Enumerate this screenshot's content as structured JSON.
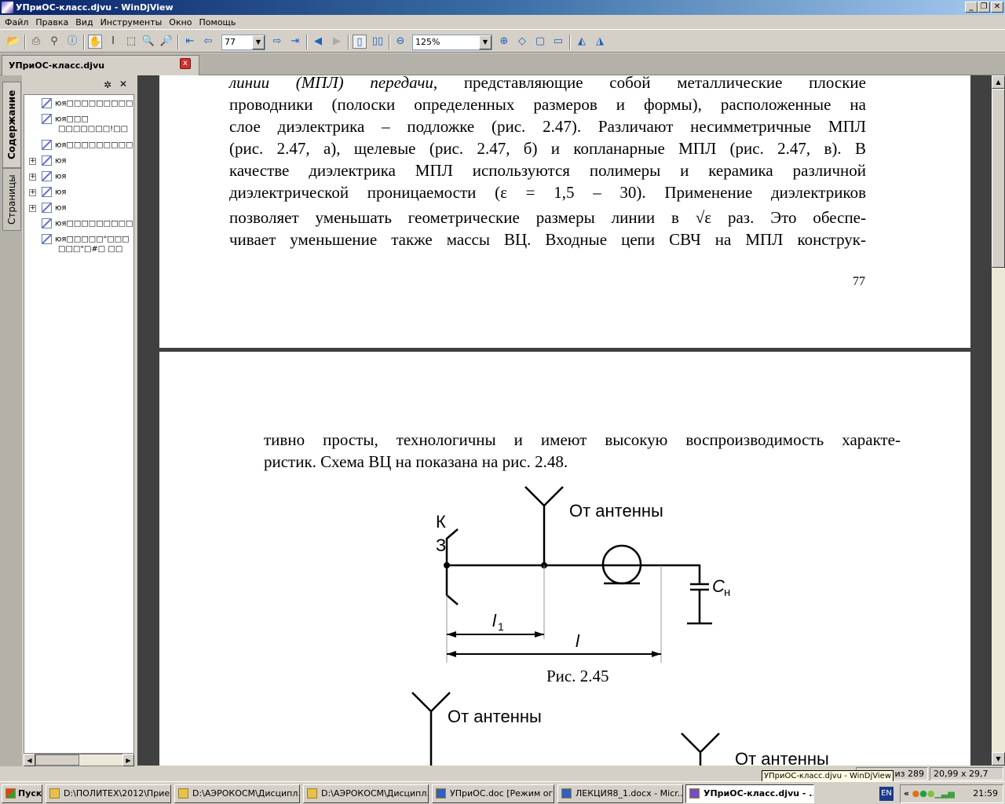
{
  "window": {
    "title": "УПриОС-класс.djvu - WinDjView",
    "minimize": "_",
    "restore": "❐",
    "close": "✕"
  },
  "menu": [
    "Файл",
    "Правка",
    "Вид",
    "Инструменты",
    "Окно",
    "Помощь"
  ],
  "toolbar": {
    "page_value": "77",
    "zoom_value": "125%"
  },
  "tab": {
    "label": "УПриОС-класс.djvu",
    "close": "x"
  },
  "sidebar": {
    "tabs": [
      "Содержание",
      "Страницы"
    ],
    "settings": "✲",
    "close": "✕",
    "items": [
      {
        "label": "юя□□□□□□□□□",
        "expandable": false
      },
      {
        "label": "юя□□□",
        "label2": "□□□□□□□!□□",
        "expandable": false
      },
      {
        "label": "юя□□□□□□□□□",
        "expandable": false
      },
      {
        "label": "юя",
        "expandable": true
      },
      {
        "label": "юя",
        "expandable": true
      },
      {
        "label": "юя",
        "expandable": true
      },
      {
        "label": "юя",
        "expandable": true
      },
      {
        "label": "юя□□□□□□□□□",
        "expandable": false
      },
      {
        "label": "юя□□□□□\"□□□",
        "label2": "□□□\"□#□ □□",
        "expandable": false
      }
    ]
  },
  "page1": {
    "lines": [
      {
        "italic": "линии (МПЛ) передачи",
        "rest": ", представляющие собой металлические плоские"
      },
      {
        "text": "проводники (полоски определенных размеров и формы), расположенные на"
      },
      {
        "text": "слое диэлектрика – подложке (рис. 2.47). Различают несимметричные МПЛ"
      },
      {
        "text": "(рис. 2.47, а), щелевые (рис. 2.47, б) и копланарные МПЛ (рис. 2.47, в). В"
      },
      {
        "text": "качестве диэлектрика МПЛ используются полимеры и керамика различной"
      },
      {
        "text": "диэлектрической проницаемости (ε = 1,5 – 30). Применение диэлектриков"
      },
      {
        "text": "позволяет уменьшать геометрические размеры линии в √ε раз. Это обеспе-"
      },
      {
        "text": "чивает уменьшение также массы ВЦ. Входные цепи СВЧ на МПЛ конструк-"
      }
    ],
    "page_number": "77"
  },
  "page2": {
    "lines": [
      "тивно просты, технологичны и имеют высокую воспроизводимость характе-",
      "ристик. Схема ВЦ на показана на рис. 2.48."
    ],
    "figure": {
      "antenna_label": "От антенны",
      "switch_label_k": "К",
      "switch_label_z": "З",
      "l1": "l",
      "l1_sub": "1",
      "l": "l",
      "cap": "C",
      "cap_sub": "н",
      "caption": "Рис. 2.45"
    },
    "figure2": {
      "antenna_label_1": "От антенны",
      "antenna_label_2": "От антенны"
    }
  },
  "statusbar": {
    "page_info": "из 289",
    "page_size": "20,99 x 29,7 см"
  },
  "tooltip": "УПриОС-класс.djvu - WinDjView",
  "taskbar": {
    "start": "Пуск",
    "tasks": [
      "D:\\ПОЛИТЕХ\\2012\\Прие...",
      "D:\\АЭРОКОСМ\\Дисципл...",
      "D:\\АЭРОКОСМ\\Дисципл...",
      "УПриОС.doc [Режим ог...",
      "ЛЕКЦИЯ8_1.docx - Micr...",
      "УПриОС-класс.djvu - ..."
    ],
    "active_task": 5,
    "lang": "EN",
    "clock": "21:59"
  }
}
